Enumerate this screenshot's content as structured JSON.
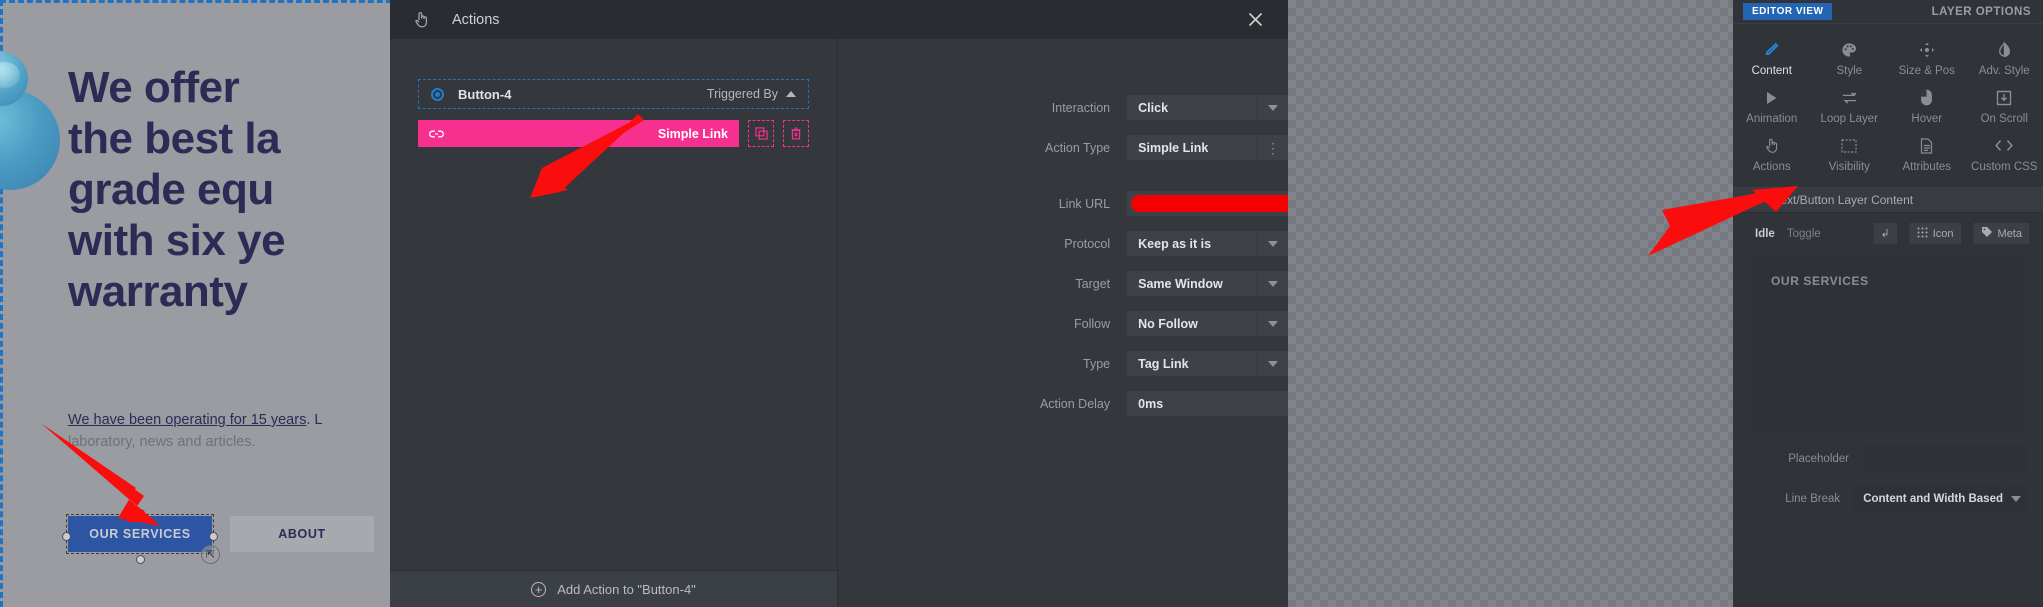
{
  "background_site": {
    "heading": "We offer\nthe best la\ngrade equ\nwith six ye\nwarranty",
    "paragraph_link": "We have been operating for 15 years",
    "paragraph_rest": ". L",
    "paragraph_line2": "laboratory, news and articles.",
    "primary_button": "OUR SERVICES",
    "secondary_button": "ABOUT"
  },
  "modal": {
    "title": "Actions",
    "title_icon": "click-hand-icon",
    "close_icon": "close-icon",
    "actions_panel": {
      "layer_name": "Button-4",
      "triggered_by_label": "Triggered By",
      "action_item_label": "Simple Link",
      "action_item_icon": "link-icon",
      "duplicate_icon": "copy-icon",
      "delete_icon": "trash-icon",
      "add_action_label": "Add Action to \"Button-4\"",
      "add_icon": "plus-circle-icon",
      "accent_color": "#f72f8e"
    },
    "form": {
      "fields": [
        {
          "label": "Interaction",
          "value": "Click",
          "control": "select"
        },
        {
          "label": "Action Type",
          "value": "Simple Link",
          "control": "menu"
        },
        {
          "label": "Link URL",
          "value": "",
          "control": "redacted",
          "spaced": true
        },
        {
          "label": "Protocol",
          "value": "Keep as it is",
          "control": "select"
        },
        {
          "label": "Target",
          "value": "Same Window",
          "control": "select"
        },
        {
          "label": "Follow",
          "value": "No Follow",
          "control": "select"
        },
        {
          "label": "Type",
          "value": "Tag Link",
          "control": "select"
        },
        {
          "label": "Action Delay",
          "value": "0ms",
          "control": "text"
        }
      ]
    }
  },
  "sidebar": {
    "editor_view_button": "EDITOR VIEW",
    "layer_options_label": "LAYER OPTIONS",
    "tabs": [
      {
        "label": "Content",
        "icon": "pencil-icon",
        "active": true
      },
      {
        "label": "Style",
        "icon": "palette-icon",
        "active": false
      },
      {
        "label": "Size & Pos",
        "icon": "move-arrows-icon",
        "active": false
      },
      {
        "label": "Adv. Style",
        "icon": "contrast-icon",
        "active": false
      },
      {
        "label": "Animation",
        "icon": "play-icon",
        "active": false
      },
      {
        "label": "Loop Layer",
        "icon": "loop-icon",
        "active": false
      },
      {
        "label": "Hover",
        "icon": "mouse-icon",
        "active": false
      },
      {
        "label": "On Scroll",
        "icon": "scroll-down-icon",
        "active": false
      },
      {
        "label": "Actions",
        "icon": "click-hand-icon",
        "active": false
      },
      {
        "label": "Visibility",
        "icon": "image-frame-icon",
        "active": false
      },
      {
        "label": "Attributes",
        "icon": "document-icon",
        "active": false
      },
      {
        "label": "Custom CSS",
        "icon": "code-icon",
        "active": false
      }
    ],
    "section_title": "Text/Button Layer Content",
    "section_icon": "text-T-icon",
    "states": {
      "idle": "Idle",
      "toggle": "Toggle"
    },
    "mini_buttons": [
      {
        "label": "",
        "icon": "return-arrow-icon"
      },
      {
        "label": "Icon",
        "icon": "grid-dots-icon"
      },
      {
        "label": "Meta",
        "icon": "tag-icon"
      }
    ],
    "content_text": "OUR SERVICES",
    "fields": [
      {
        "label": "Placeholder",
        "value": "",
        "control": "text"
      },
      {
        "label": "Line Break",
        "value": "Content and Width Based",
        "control": "select"
      }
    ]
  },
  "annotations": {
    "arrow_color": "#fc0d0d",
    "arrows": [
      "points-to-simple-link-action",
      "points-to-our-services-button",
      "points-to-actions-tab"
    ]
  }
}
